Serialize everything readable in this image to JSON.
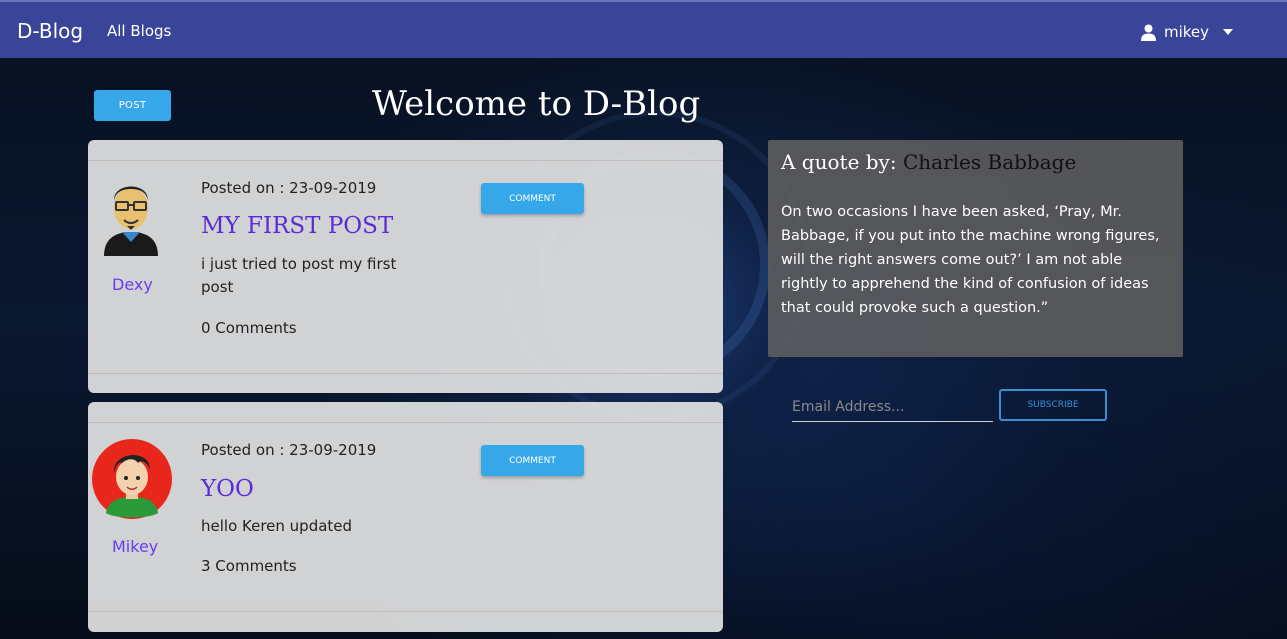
{
  "navbar": {
    "brand": "D-Blog",
    "links": [
      {
        "label": "All Blogs"
      }
    ],
    "user": {
      "name": "mikey",
      "icon": "user-icon"
    }
  },
  "page": {
    "post_button": "POST",
    "welcome_title": "Welcome to D-Blog"
  },
  "posts": [
    {
      "author": "Dexy",
      "posted_on": "Posted on : 23-09-2019",
      "title": "MY FIRST POST",
      "body": "i just tried to post my first post",
      "comments": "0 Comments",
      "comment_button": "COMMENT"
    },
    {
      "author": "Mikey",
      "posted_on": "Posted on : 23-09-2019",
      "title": "YOO",
      "body": "hello Keren updated",
      "comments": "3 Comments",
      "comment_button": "COMMENT"
    }
  ],
  "quote": {
    "prefix": "A quote by:",
    "author": "Charles Babbage",
    "text": "On two occasions I have been asked, ‘Pray, Mr. Babbage, if you put into the machine wrong figures, will the right answers come out?’ I am not able rightly to apprehend the kind of confusion of ideas that could provoke such a question.”"
  },
  "subscribe": {
    "placeholder": "Email Address...",
    "button": "SUBSCRIBE"
  },
  "colors": {
    "navbar": "#3a4599",
    "accent": "#36a8ea",
    "title_purple": "#5a2bd6"
  }
}
